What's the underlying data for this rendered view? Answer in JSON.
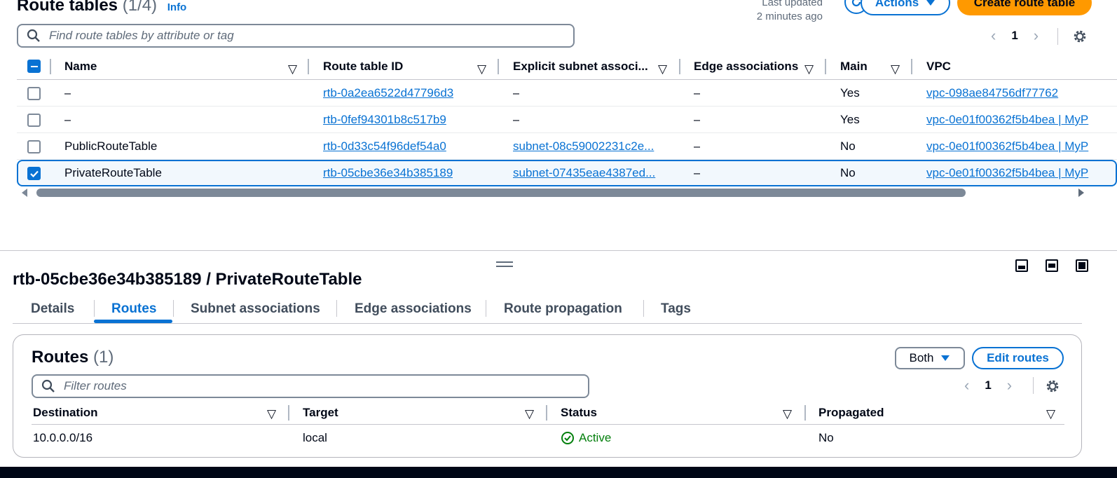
{
  "header": {
    "title": "Route tables",
    "count": "(1/4)",
    "info": "Info",
    "last_updated_label": "Last updated",
    "last_updated_value": "2 minutes ago",
    "actions_label": "Actions",
    "create_label": "Create route table"
  },
  "search": {
    "placeholder": "Find route tables by attribute or tag"
  },
  "pager": {
    "page": "1"
  },
  "table": {
    "columns": [
      "Name",
      "Route table ID",
      "Explicit subnet associ...",
      "Edge associations",
      "Main",
      "VPC"
    ],
    "rows": [
      {
        "name": "–",
        "id": "rtb-0a2ea6522d47796d3",
        "subnet": "–",
        "edge": "–",
        "main": "Yes",
        "vpc": "vpc-098ae84756df77762",
        "selected": false
      },
      {
        "name": "–",
        "id": "rtb-0fef94301b8c517b9",
        "subnet": "–",
        "edge": "–",
        "main": "Yes",
        "vpc": "vpc-0e01f00362f5b4bea | MyP",
        "selected": false
      },
      {
        "name": "PublicRouteTable",
        "id": "rtb-0d33c54f96def54a0",
        "subnet": "subnet-08c59002231c2e...",
        "edge": "–",
        "main": "No",
        "vpc": "vpc-0e01f00362f5b4bea | MyP",
        "selected": false
      },
      {
        "name": "PrivateRouteTable",
        "id": "rtb-05cbe36e34b385189",
        "subnet": "subnet-07435eae4387ed...",
        "edge": "–",
        "main": "No",
        "vpc": "vpc-0e01f00362f5b4bea | MyP",
        "selected": true
      }
    ]
  },
  "detail": {
    "title": "rtb-05cbe36e34b385189 / PrivateRouteTable",
    "tabs": [
      "Details",
      "Routes",
      "Subnet associations",
      "Edge associations",
      "Route propagation",
      "Tags"
    ],
    "active_tab": "Routes"
  },
  "routes": {
    "title": "Routes",
    "count": "(1)",
    "filter_label": "Both",
    "edit_label": "Edit routes",
    "search_placeholder": "Filter routes",
    "page": "1",
    "columns": [
      "Destination",
      "Target",
      "Status",
      "Propagated"
    ],
    "rows": [
      {
        "destination": "10.0.0.0/16",
        "target": "local",
        "status": "Active",
        "propagated": "No"
      }
    ]
  },
  "colors": {
    "accent": "#0972d3",
    "primary_button": "#ff9900",
    "success": "#037f0c",
    "text": "#000716"
  }
}
